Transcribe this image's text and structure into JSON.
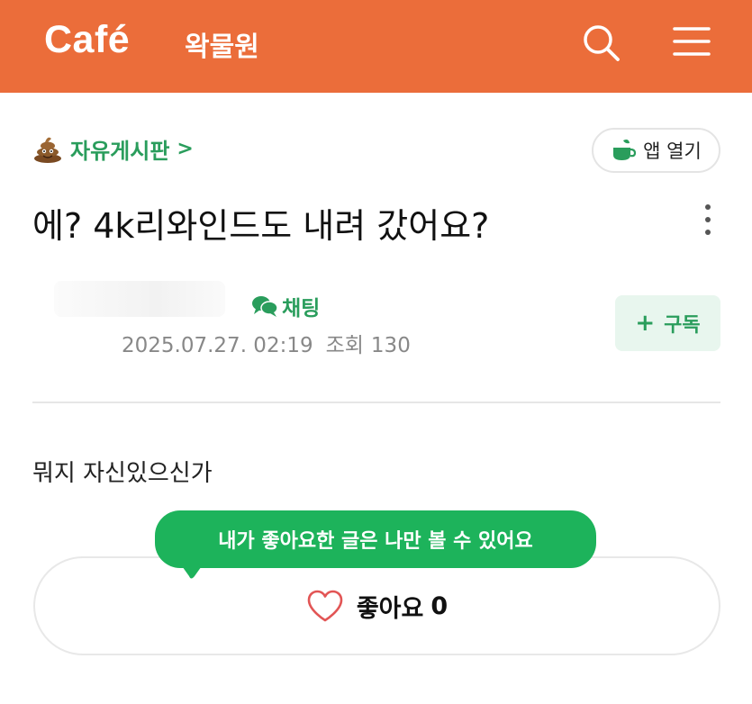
{
  "header": {
    "logo": "Café",
    "cafe_name": "왁물원",
    "bg_color": "#EB6D3A",
    "icons": [
      "search-icon",
      "menu-icon"
    ]
  },
  "board": {
    "icon": "poop-icon",
    "label": "자유게시판",
    "chevron": ">"
  },
  "app_open": {
    "icon": "cup-icon",
    "label": "앱 열기"
  },
  "post": {
    "title": "에? 4k리와인드도 내려 갔어요?",
    "chat_label": "채팅",
    "date": "2025.07.27. 02:19",
    "views_label": "조회",
    "views": "130",
    "body": "뭐지 자신있으신가"
  },
  "subscribe": {
    "plus": "+",
    "label": "구독"
  },
  "like": {
    "tooltip": "내가 좋아요한 글은 나만 볼 수 있어요",
    "label": "좋아요",
    "count": "0",
    "heart_color": "#e25555"
  },
  "colors": {
    "accent_green": "#2a9d5c",
    "tooltip_green": "#1db35b"
  }
}
